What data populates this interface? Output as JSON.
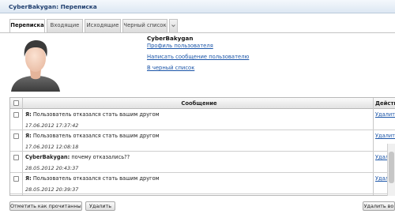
{
  "header": {
    "title": "CyberBakygan: Переписка"
  },
  "tabs": [
    {
      "label": "Переписка",
      "active": true
    },
    {
      "label": "Входящие",
      "active": false
    },
    {
      "label": "Исходящие",
      "active": false
    },
    {
      "label": "Черный список",
      "active": false
    }
  ],
  "tab_dropdown_icon": "chevron-down-icon",
  "profile": {
    "username": "CyberBakygan",
    "profile_link": "Профиль пользователя",
    "write_message_link": "Написать сообщение пользователю",
    "blacklist_link": "В черный список"
  },
  "table": {
    "col_message": "Сообщение",
    "col_action": "Действ"
  },
  "messages": [
    {
      "sender": "Я:",
      "text": "Пользователь отказался стать вашим другом",
      "date": "17.06.2012 17:37:42",
      "action": "Удалить"
    },
    {
      "sender": "Я:",
      "text": "Пользователь отказался стать вашим другом",
      "date": "17.06.2012 12:08:18",
      "action": "Удалить"
    },
    {
      "sender": "CyberBakygan:",
      "text": "почему отказались??",
      "date": "28.05.2012 20:43:37",
      "action": "Удалить"
    },
    {
      "sender": "Я:",
      "text": "Пользователь отказался стать вашим другом",
      "date": "28.05.2012 20:39:37",
      "action": "Удалить"
    }
  ],
  "buttons": {
    "mark_read": "Отметить как прочитанные",
    "delete": "Удалить",
    "delete_all": "Удалить во"
  },
  "colors": {
    "link": "#1b55a8",
    "title": "#1f3e6e"
  }
}
